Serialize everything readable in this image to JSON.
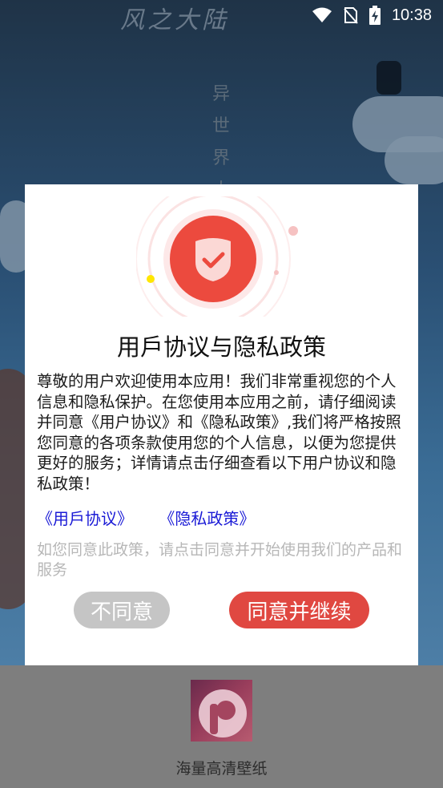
{
  "statusbar": {
    "time": "10:38"
  },
  "background": {
    "title": "风之大陆",
    "vertical_text": [
      "异",
      "世",
      "界",
      "大"
    ]
  },
  "dialog": {
    "title": "用戶协议与隐私政策",
    "body": "尊敬的用户欢迎使用本应用！我们非常重视您的个人信息和隐私保护。在您使用本应用之前，请仔细阅读并同意《用户协议》和《隐私政策》,我们将严格按照您同意的各项条款使用您的个人信息，以便为您提供更好的服务；详情请点击仔细查看以下用户协议和隐私政策！",
    "links": {
      "user_agreement": "《用戶协议》",
      "privacy_policy": "《隐私政策》"
    },
    "note": "如您同意此政策，请点击同意并开始使用我们的产品和服务",
    "buttons": {
      "disagree": "不同意",
      "agree": "同意并继续"
    },
    "colors": {
      "accent": "#e04841",
      "link": "#1a1ad6",
      "disabled": "#c5c5c5"
    }
  },
  "splash": {
    "app_name": "海量高清壁纸"
  }
}
